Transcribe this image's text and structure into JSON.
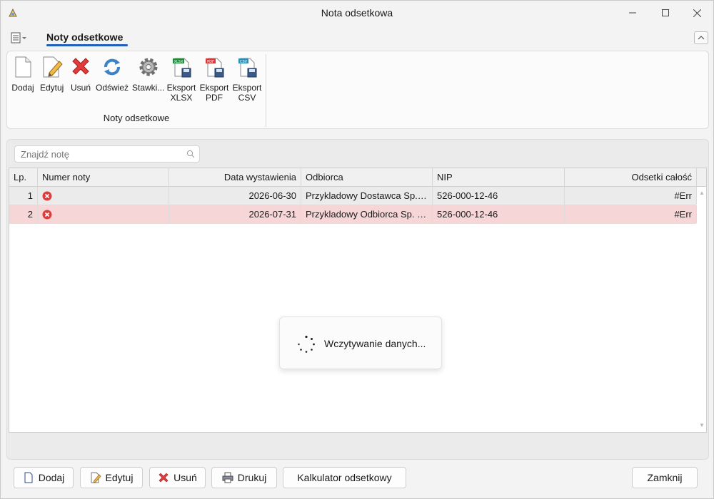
{
  "window": {
    "title": "Nota odsetkowa"
  },
  "ribbon": {
    "tab": "Noty odsetkowe",
    "group_label": "Noty odsetkowe",
    "buttons": [
      {
        "id": "add",
        "label": "Dodaj",
        "icon": "new-document-icon"
      },
      {
        "id": "edit",
        "label": "Edytuj",
        "icon": "edit-document-icon"
      },
      {
        "id": "delete",
        "label": "Usuń",
        "icon": "red-x-icon"
      },
      {
        "id": "refresh",
        "label": "Odśwież",
        "icon": "refresh-icon"
      },
      {
        "id": "rates",
        "label": "Stawki...",
        "icon": "gear-icon"
      },
      {
        "id": "xlsx",
        "label": "Eksport XLSX",
        "icon": "export-xlsx-icon"
      },
      {
        "id": "pdf",
        "label": "Eksport PDF",
        "icon": "export-pdf-icon"
      },
      {
        "id": "csv",
        "label": "Eksport CSV",
        "icon": "export-csv-icon"
      }
    ]
  },
  "search": {
    "placeholder": "Znajdź notę",
    "value": ""
  },
  "table": {
    "columns": [
      "Lp.",
      "Numer noty",
      "Data wystawienia",
      "Odbiorca",
      "NIP",
      "Odsetki całość"
    ],
    "rows": [
      {
        "lp": "1",
        "numer": "",
        "status_icon": "error-icon",
        "data": "2026-06-30",
        "odbiorca": "Przykladowy Dostawca Sp. z o.o.",
        "nip": "526-000-12-46",
        "odsetki": "#Err",
        "highlight": false
      },
      {
        "lp": "2",
        "numer": "",
        "status_icon": "error-icon",
        "data": "2026-07-31",
        "odbiorca": "Przykladowy Odbiorca Sp. z o.o.",
        "nip": "526-000-12-46",
        "odsetki": "#Err",
        "highlight": true
      }
    ]
  },
  "loading": {
    "text": "Wczytywanie danych..."
  },
  "footer": {
    "add": "Dodaj",
    "edit": "Edytuj",
    "delete": "Usuń",
    "print": "Drukuj",
    "calculator": "Kalkulator odsetkowy",
    "close": "Zamknij"
  },
  "colors": {
    "accent": "#1f5fbf",
    "row_highlight": "#f6d6d6",
    "row_selected": "#ebebeb",
    "error": "#e03c3c"
  }
}
